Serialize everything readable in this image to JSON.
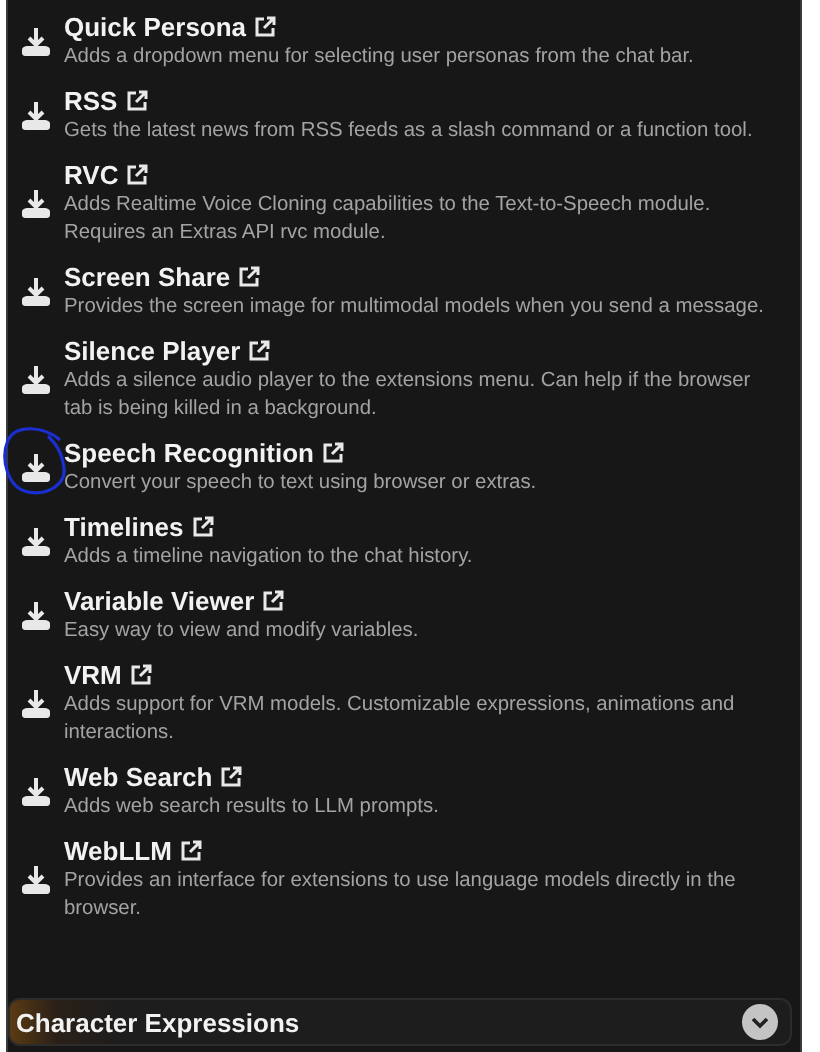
{
  "extensions": [
    {
      "name": "Quick Persona",
      "description": "Adds a dropdown menu for selecting user personas from the chat bar.",
      "circled": false
    },
    {
      "name": "RSS",
      "description": "Gets the latest news from RSS feeds as a slash command or a function tool.",
      "circled": false
    },
    {
      "name": "RVC",
      "description": "Adds Realtime Voice Cloning capabilities to the Text-to-Speech module. Requires an Extras API rvc module.",
      "circled": false
    },
    {
      "name": "Screen Share",
      "description": "Provides the screen image for multimodal models when you send a message.",
      "circled": false
    },
    {
      "name": "Silence Player",
      "description": "Adds a silence audio player to the extensions menu. Can help if the browser tab is being killed in a background.",
      "circled": false
    },
    {
      "name": "Speech Recognition",
      "description": "Convert your speech to text using browser or extras.",
      "circled": true
    },
    {
      "name": "Timelines",
      "description": "Adds a timeline navigation to the chat history.",
      "circled": false
    },
    {
      "name": "Variable Viewer",
      "description": "Easy way to view and modify variables.",
      "circled": false
    },
    {
      "name": "VRM",
      "description": "Adds support for VRM models. Customizable expressions, animations and interactions.",
      "circled": false
    },
    {
      "name": "Web Search",
      "description": "Adds web search results to LLM prompts.",
      "circled": false
    },
    {
      "name": "WebLLM",
      "description": "Provides an interface for extensions to use language models directly in the browser.",
      "circled": false
    }
  ],
  "section": {
    "title": "Character Expressions",
    "expanded": false
  }
}
